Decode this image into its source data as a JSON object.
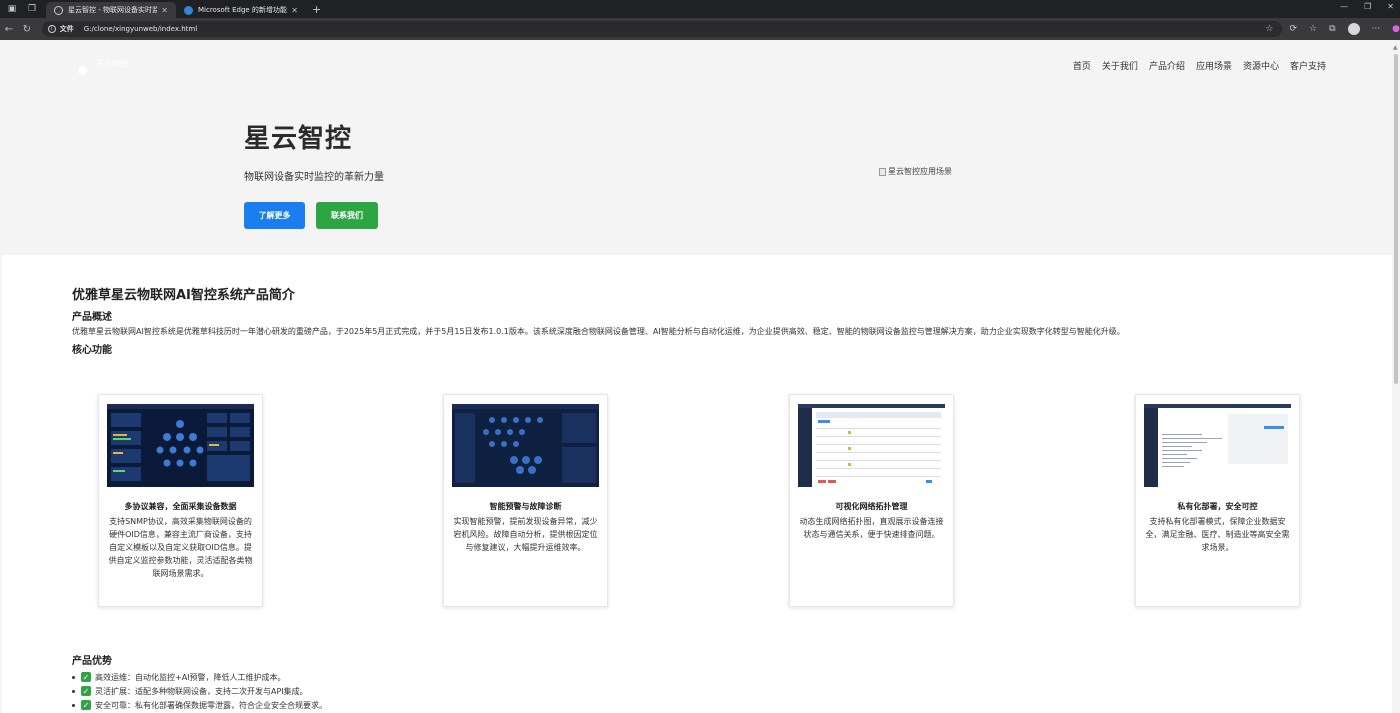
{
  "browser": {
    "tabs": [
      {
        "title": "星云智控 - 物联网设备实时监控与",
        "active": true
      },
      {
        "title": "Microsoft Edge 的新增功能",
        "active": false
      }
    ],
    "address": {
      "scheme": "文件",
      "path": "G:/clone/xingyunweb/index.html"
    }
  },
  "site": {
    "logo_text": "星云智控",
    "menu": [
      "首页",
      "关于我们",
      "产品介绍",
      "应用场景",
      "资源中心",
      "客户支持"
    ]
  },
  "hero": {
    "title": "星云智控",
    "subtitle": "物联网设备实时监控的革新力量",
    "btn_learn": "了解更多",
    "btn_contact": "联系我们",
    "image_alt": "星云智控应用场景"
  },
  "intro": {
    "heading": "优雅草星云物联网AI智控系统产品简介",
    "overview_title": "产品概述",
    "overview_text": "优雅草星云物联网AI智控系统是优雅草科技历时一年潜心研发的重磅产品，于2025年5月正式完成，并于5月15日发布1.0.1版本。该系统深度融合物联网设备管理、AI智能分析与自动化运维，为企业提供高效、稳定、智能的物联网设备监控与管理解决方案，助力企业实现数字化转型与智能化升级。",
    "core_title": "核心功能"
  },
  "cards": [
    {
      "title": "多协议兼容，全面采集设备数据",
      "desc": "支持SNMP协议，高效采集物联网设备的硬件OID信息，兼容主流厂商设备，支持自定义模板以及自定义获取OID信息。提供自定义监控参数功能，灵活适配各类物联网场景需求。",
      "theme": "dark"
    },
    {
      "title": "智能预警与故障诊断",
      "desc": "实现智能预警，提前发现设备异常，减少宕机风险。故障自动分析，提供根因定位与修复建议，大幅提升运维效率。",
      "theme": "dark"
    },
    {
      "title": "可视化网络拓扑管理",
      "desc": "动态生成网络拓扑图，直观展示设备连接状态与通信关系，便于快速排查问题。",
      "theme": "light"
    },
    {
      "title": "私有化部署，安全可控",
      "desc": "支持私有化部署模式，保障企业数据安全，满足金融、医疗、制造业等高安全需求场景。",
      "theme": "light"
    }
  ],
  "advantages": {
    "title": "产品优势",
    "items": [
      "高效运维：自动化监控+AI预警，降低人工维护成本。",
      "灵活扩展：适配多种物联网设备，支持二次开发与API集成。",
      "安全可靠：私有化部署确保数据零泄露，符合企业安全合规要求。"
    ]
  },
  "colors": {
    "primary": "#1a7ef0",
    "success": "#2ea543",
    "hero_bg": "#f4f4f4"
  }
}
